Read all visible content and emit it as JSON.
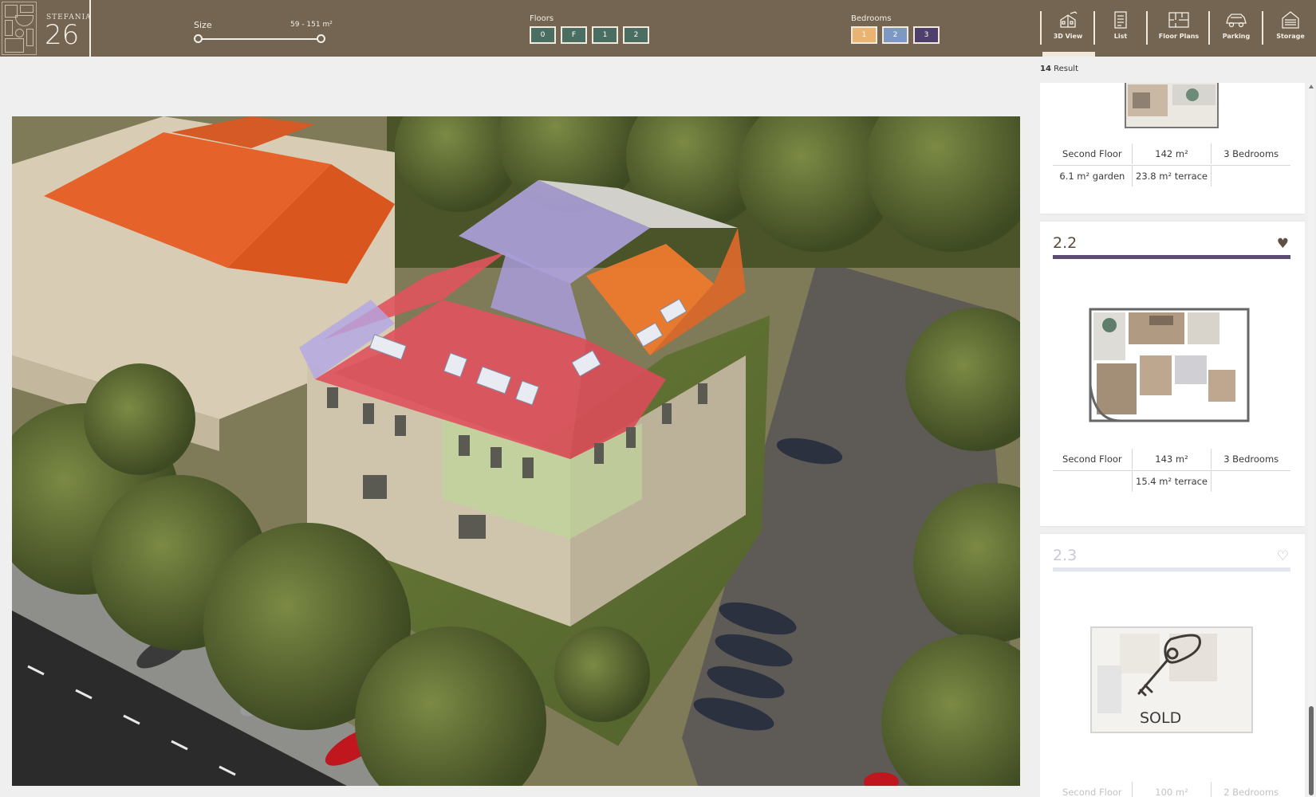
{
  "brand": {
    "small": "STEFANIA",
    "number": "26"
  },
  "filters": {
    "size": {
      "label": "Size",
      "value": "59 - 151 m²",
      "min_fraction": 0.0,
      "max_fraction": 1.0
    },
    "floors": {
      "label": "Floors",
      "options": [
        "0",
        "F",
        "1",
        "2"
      ],
      "color": "#4a6e61"
    },
    "bedrooms": {
      "label": "Bedrooms",
      "options": [
        {
          "label": "1",
          "color": "#e9b472"
        },
        {
          "label": "2",
          "color": "#7e98c4"
        },
        {
          "label": "3",
          "color": "#4f3f6c"
        }
      ]
    }
  },
  "nav": {
    "items": [
      {
        "label": "3D View",
        "icon": "3d-building-icon",
        "active": true
      },
      {
        "label": "List",
        "icon": "list-document-icon",
        "active": false
      },
      {
        "label": "Floor Plans",
        "icon": "floor-plan-icon",
        "active": false
      },
      {
        "label": "Parking",
        "icon": "car-icon",
        "active": false
      },
      {
        "label": "Storage",
        "icon": "storage-house-icon",
        "active": false
      }
    ]
  },
  "results": {
    "count": "14",
    "label": "Result",
    "cards": [
      {
        "title": "",
        "specs_row1": [
          "Second Floor",
          "142 m²",
          "3 Bedrooms"
        ],
        "specs_row2": [
          "6.1 m² garden",
          "23.8 m² terrace",
          ""
        ],
        "sold": false
      },
      {
        "title": "2.2",
        "specs_row1": [
          "Second Floor",
          "143 m²",
          "3 Bedrooms"
        ],
        "specs_row2": [
          "",
          "15.4 m² terrace",
          ""
        ],
        "bar_color": "#5c4e72",
        "sold": false
      },
      {
        "title": "2.3",
        "specs_row1": [
          "Second Floor",
          "100 m²",
          "2 Bedrooms"
        ],
        "sold": true,
        "sold_label": "SOLD"
      }
    ]
  },
  "colors": {
    "topbar": "#736552",
    "bedroom_3": "#4f3f6c",
    "highlight_pink": "#e0545e",
    "highlight_purple": "#b3a6e6",
    "highlight_orange": "#ee7a2d",
    "highlight_green": "#bfd49a"
  }
}
